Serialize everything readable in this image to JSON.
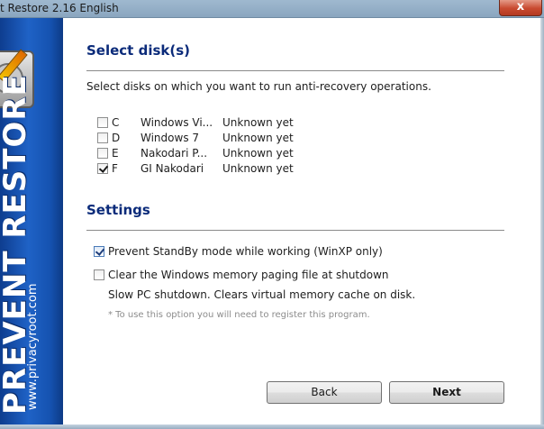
{
  "window": {
    "title": "t Restore 2.16 English",
    "close_glyph": "x"
  },
  "banner": {
    "brand": "PREVENT RESTORE",
    "site": "www.privacyroot.com"
  },
  "select_disks": {
    "heading": "Select disk(s)",
    "description": "Select disks on which you want to run anti-recovery operations.",
    "disks": [
      {
        "checked": false,
        "letter": "C",
        "label": "Windows Vi...",
        "status": "Unknown yet"
      },
      {
        "checked": false,
        "letter": "D",
        "label": "Windows 7",
        "status": "Unknown yet"
      },
      {
        "checked": false,
        "letter": "E",
        "label": "Nakodari P...",
        "status": "Unknown yet"
      },
      {
        "checked": true,
        "letter": "F",
        "label": "GI Nakodari",
        "status": "Unknown yet"
      }
    ]
  },
  "settings": {
    "heading": "Settings",
    "prevent_standby": {
      "checked": true,
      "label": "Prevent StandBy mode while working (WinXP only)"
    },
    "clear_paging": {
      "checked": false,
      "label": "Clear the Windows memory paging file at shutdown"
    },
    "clear_paging_note": "Slow PC shutdown. Clears virtual memory cache on disk.",
    "register_note": "* To use this option you will need to register this program."
  },
  "buttons": {
    "back": "Back",
    "next": "Next"
  }
}
